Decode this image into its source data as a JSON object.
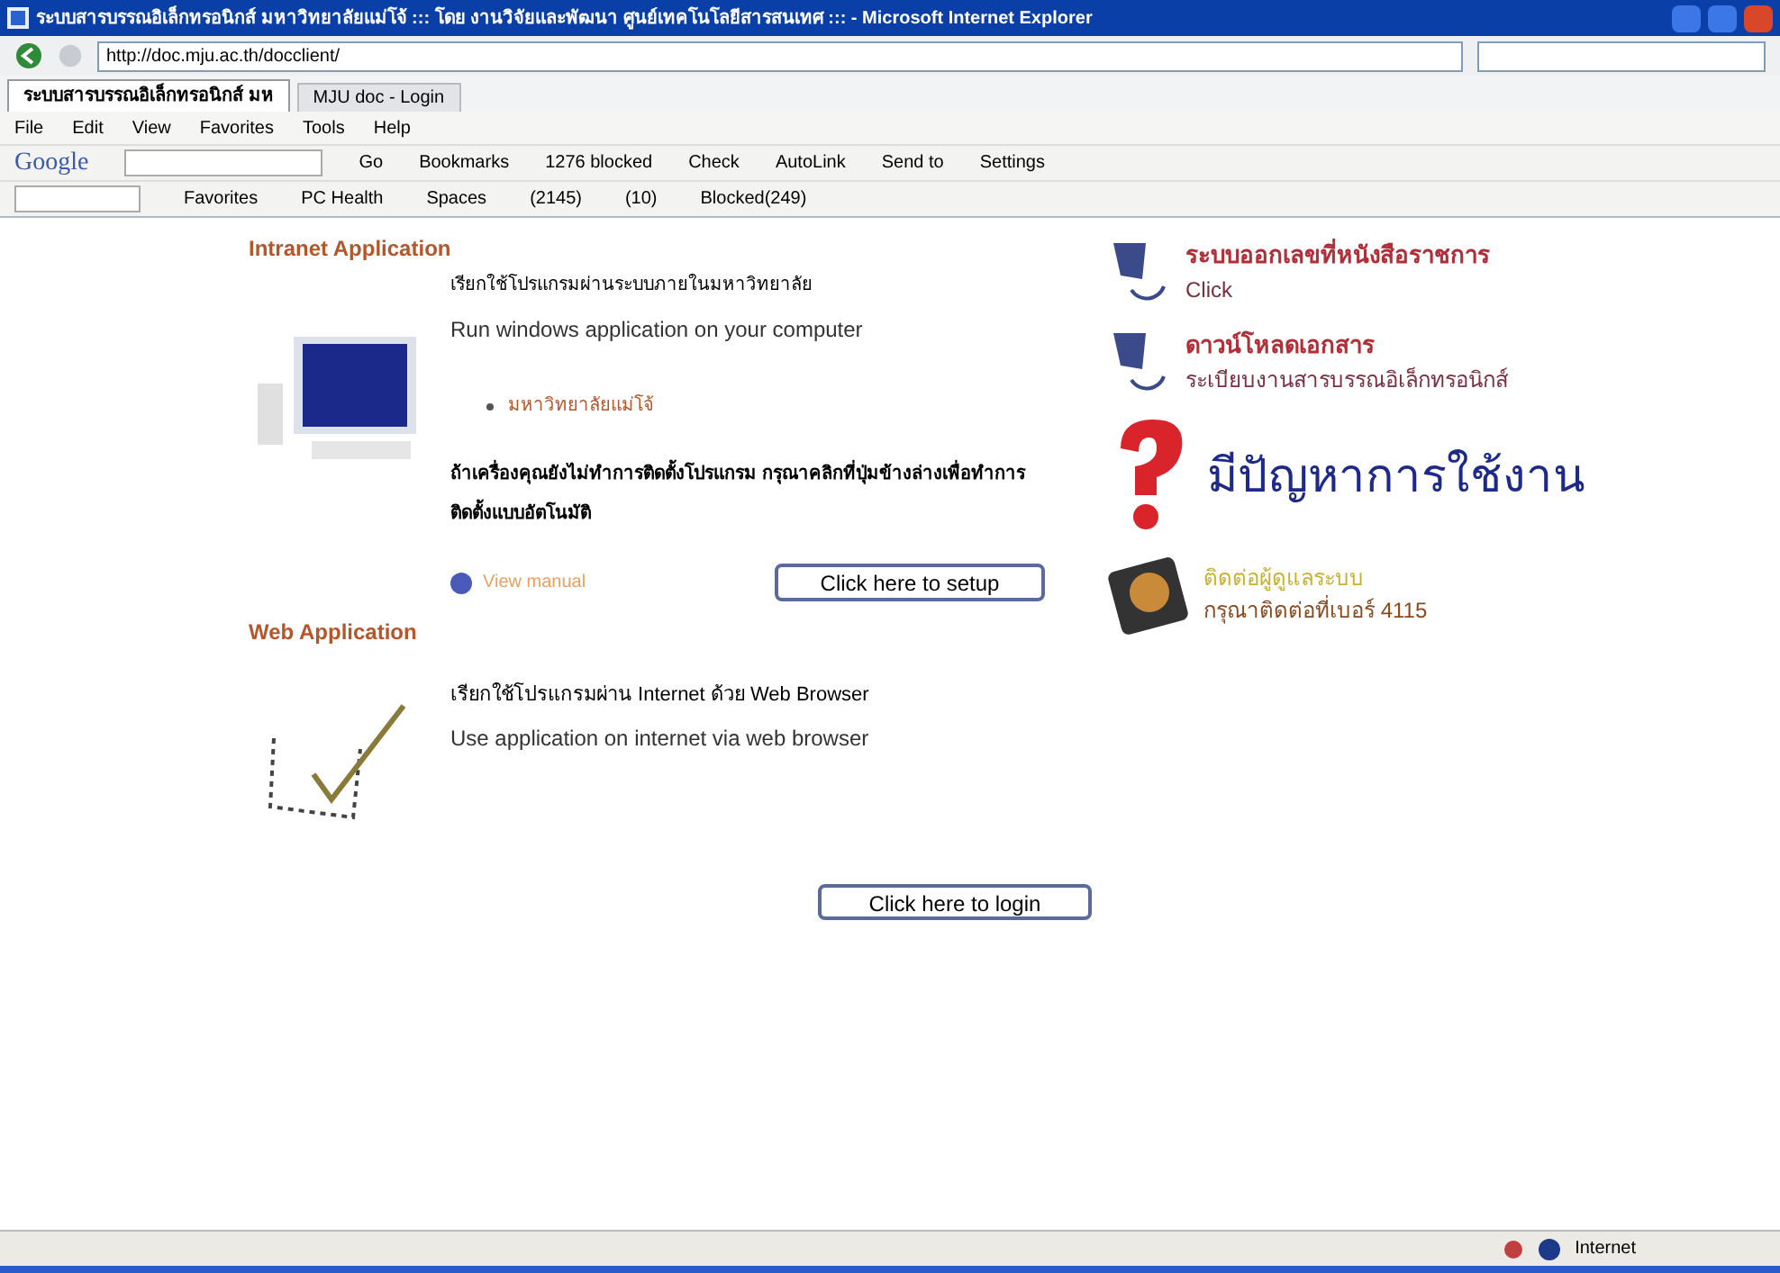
{
  "window": {
    "title": "ระบบสารบรรณอิเล็กทรอนิกส์ มหาวิทยาลัยแม่โจ้ ::: โดย งานวิจัยและพัฒนา ศูนย์เทคโนโลยีสารสนเทศ ::: - Microsoft Internet Explorer"
  },
  "address": {
    "value": "http://doc.mju.ac.th/docclient/"
  },
  "tabs": [
    {
      "label": "ระบบสารบรรณอิเล็กทรอนิกส์ มห",
      "selected": true
    },
    {
      "label": "MJU doc - Login",
      "selected": false
    }
  ],
  "menu": [
    "File",
    "Edit",
    "View",
    "Favorites",
    "Tools",
    "Help"
  ],
  "google_toolbar": {
    "logo": "Google",
    "items": [
      "Go",
      "Bookmarks",
      "1276 blocked",
      "Check",
      "AutoLink",
      "Send to",
      "Settings"
    ]
  },
  "live_toolbar": {
    "items": [
      "Favorites",
      "PC Health",
      "Spaces",
      "(2145)",
      "(10)",
      "Blocked(249)"
    ]
  },
  "intranet": {
    "heading": "Intranet Application",
    "thai_line": "เรียกใช้โปรแกรมผ่านระบบภายในมหาวิทยาลัย",
    "line": "Run windows application on your computer",
    "link": "มหาวิทยาลัยแม่โจ้",
    "note": "ถ้าเครื่องคุณยังไม่ทำการติดตั้งโปรแกรม กรุณาคลิกที่ปุ่มข้างล่างเพื่อทำการติดตั้งแบบอัตโนมัติ",
    "manual": "View manual",
    "button": "Click here to setup"
  },
  "web": {
    "heading": "Web Application",
    "thai_line": "เรียกใช้โปรแกรมผ่าน Internet ด้วย Web Browser",
    "line": "Use application on internet via web browser",
    "button": "Click here to login"
  },
  "side": [
    {
      "kind": "doc",
      "title": "ระบบออกเลขที่หนังสือราชการ",
      "sub": "Click"
    },
    {
      "kind": "doc",
      "title": "ดาวน์โหลดเอกสาร",
      "sub": "ระเบียบงานสารบรรณอิเล็กทรอนิกส์"
    },
    {
      "kind": "help",
      "title": "มีปัญหาการใช้งาน"
    },
    {
      "kind": "disk",
      "title": "ติดต่อผู้ดูแลระบบ",
      "sub": "กรุณาติดต่อที่เบอร์ 4115"
    }
  ],
  "status_bar": {
    "zone": "Internet"
  }
}
